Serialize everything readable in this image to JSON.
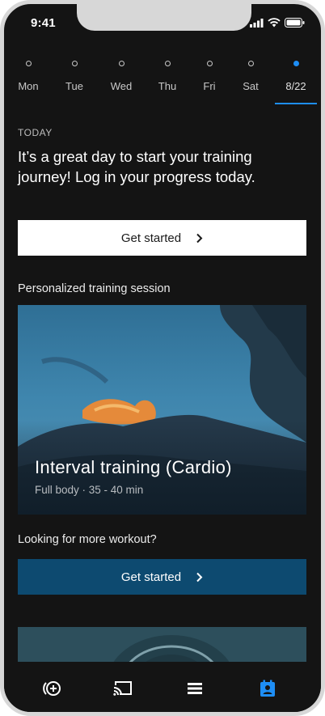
{
  "status": {
    "time": "9:41"
  },
  "week": {
    "days": [
      {
        "label": "Mon",
        "active": false
      },
      {
        "label": "Tue",
        "active": false
      },
      {
        "label": "Wed",
        "active": false
      },
      {
        "label": "Thu",
        "active": false
      },
      {
        "label": "Fri",
        "active": false
      },
      {
        "label": "Sat",
        "active": false
      },
      {
        "label": "8/22",
        "active": true
      }
    ]
  },
  "today": {
    "label": "TODAY",
    "headline": "It’s a great day to start your training journey! Log in your progress today.",
    "button": "Get started"
  },
  "session": {
    "label": "Personalized training session",
    "title": "Interval training (Cardio)",
    "subtitle": "Full body · 35 - 40 min"
  },
  "more": {
    "label": "Looking for more workout?",
    "button": "Get started"
  },
  "colors": {
    "accent": "#1e8ef5",
    "button_blue": "#0d4a70",
    "background": "#141414"
  },
  "tabs": [
    {
      "icon": "add-circle-icon",
      "active": false
    },
    {
      "icon": "cast-icon",
      "active": false
    },
    {
      "icon": "list-icon",
      "active": false
    },
    {
      "icon": "calendar-person-icon",
      "active": true
    }
  ]
}
